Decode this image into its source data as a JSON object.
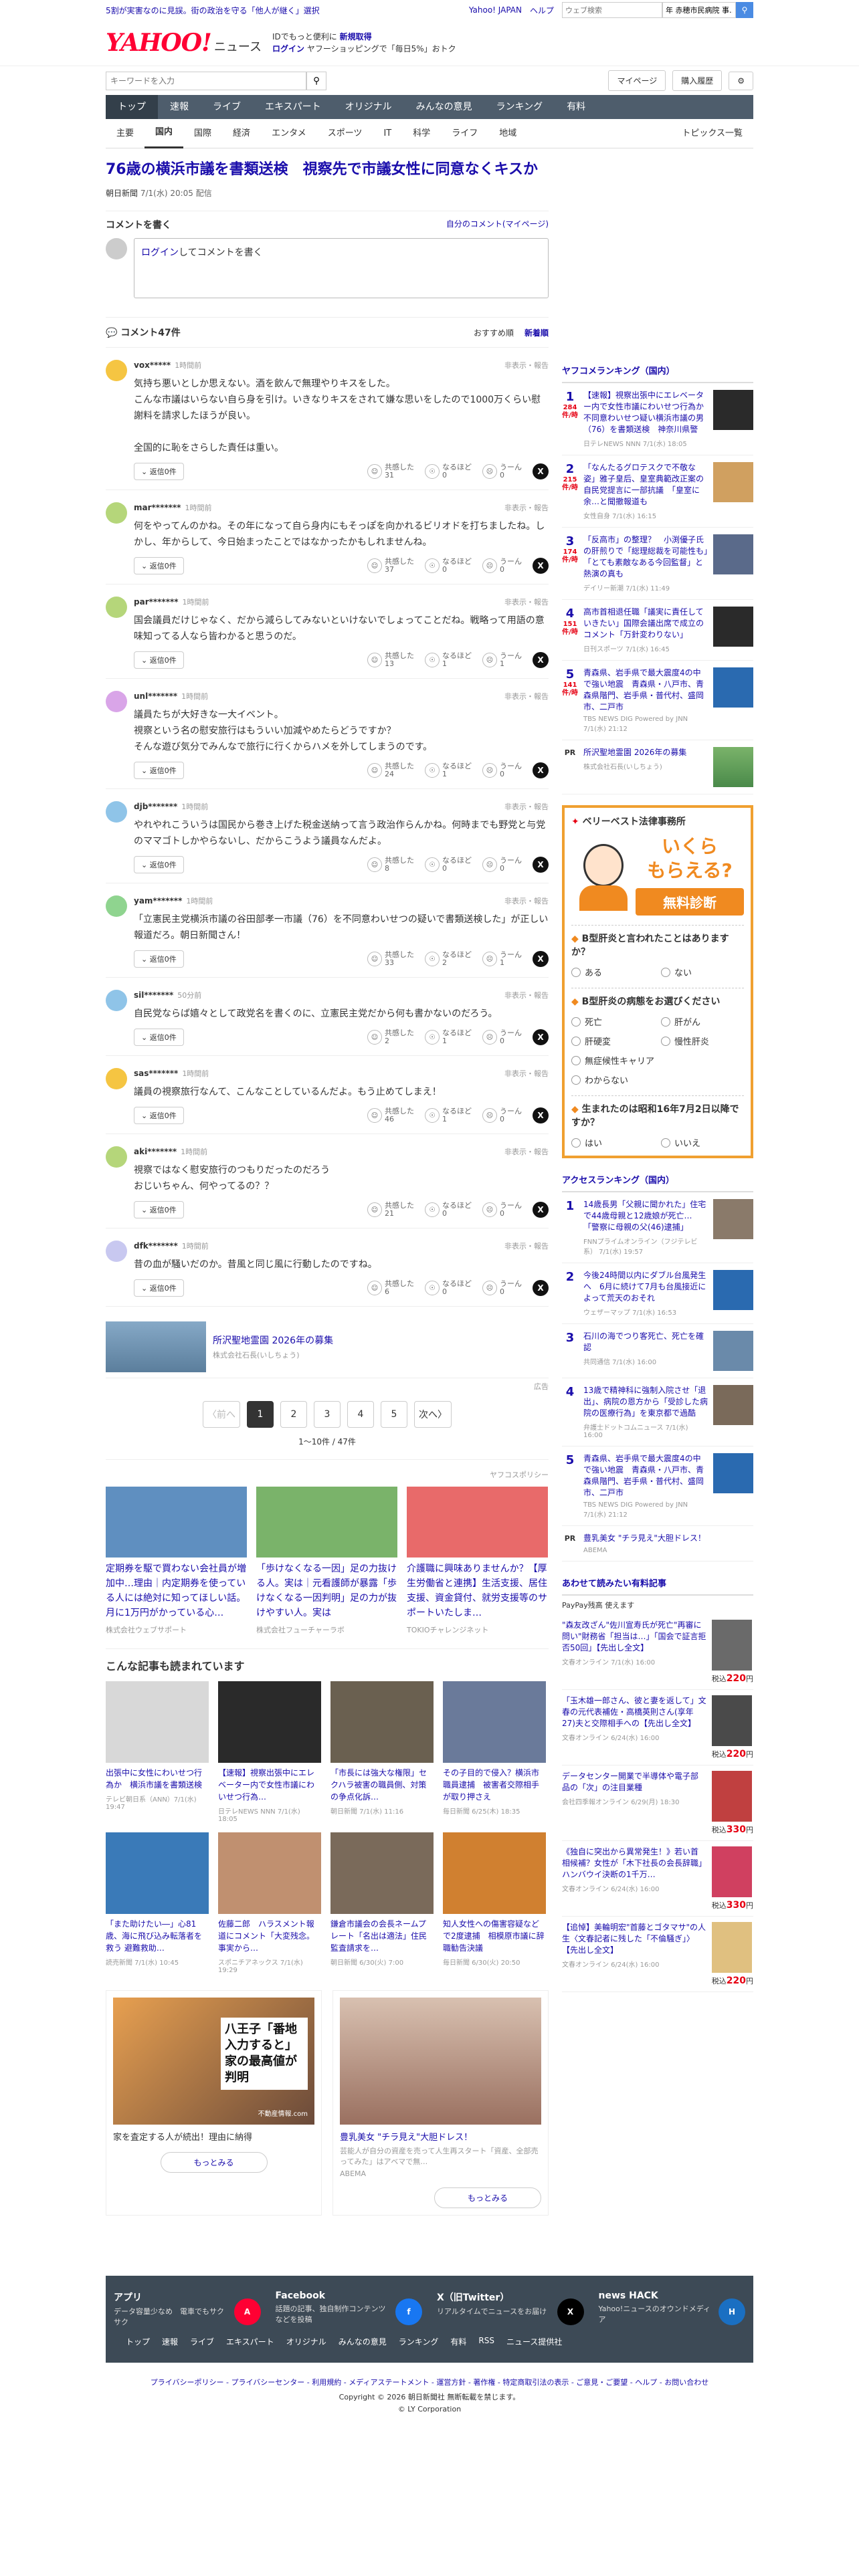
{
  "topbar": {
    "promo_prefix": "5割が業界歩手前…",
    "promo": "5割が実害なのに見誤。街の政治を守る「他人が継く」選択",
    "right_links": [
      "Yahoo! JAPAN",
      "ヘルプ"
    ],
    "search_placeholder": "ウェブ検索",
    "search_value": "年 赤穂市民病院 事…"
  },
  "header": {
    "logo_text": "YAHOO!",
    "logo_sub": "JAPAN",
    "logo_news": "ニュース",
    "line1_prefix": "IDでもっと便利に",
    "line1_link": "新規取得",
    "line2_link": "ログイン",
    "line2_text": "ヤフーショッピングで「毎日5%」おトク"
  },
  "searchrow": {
    "placeholder": "キーワードを入力",
    "mypage": "マイページ",
    "buy": "購入履歴"
  },
  "catnav": [
    "トップ",
    "速報",
    "ライブ",
    "エキスパート",
    "オリジナル",
    "みんなの意見",
    "ランキング",
    "有料"
  ],
  "subnav": [
    "主要",
    "国内",
    "国際",
    "経済",
    "エンタメ",
    "スポーツ",
    "IT",
    "科学",
    "ライフ",
    "地域"
  ],
  "subnav_right": "トピックス一覧",
  "article": {
    "title": "76歳の横浜市議を書類送検　視察先で市議女性に同意なくキスか",
    "source": "朝日新聞",
    "date": "7/1(水) 20:05 配信"
  },
  "comment_write": {
    "title": "コメントを書く",
    "mine": "自分のコメント(マイページ)",
    "login_link": "ログイン",
    "login_text": "してコメントを書く"
  },
  "comment_list": {
    "title": "コメント47件",
    "sort_rec": "おすすめ順",
    "sort_new": "新着順"
  },
  "comments": [
    {
      "user": "vox*****",
      "time": "1時間前",
      "text": "気持ち悪いとしか思えない。酒を飲んで無理やりキスをした。\nこんな市議はいらない自ら身を引け。いきなりキスをされて嫌な思いをしたので1000万くらい慰謝料を請求したほうが良い。\n\n全国的に恥をさらした責任は重い。",
      "react": [
        "共感した\n31",
        "なるほど\n0",
        "うーん\n0"
      ],
      "avatar": "#f5c542"
    },
    {
      "user": "mar*******",
      "time": "1時間前",
      "text": "何をやってんのかね。その年になって自ら身内にもそっぽを向かれるビリオドを打ちましたね。しかし、年からして、今日始まったことではなかったかもしれませんね。",
      "react": [
        "共感した\n37",
        "なるほど\n0",
        "うーん\n0"
      ],
      "avatar": "#b5d67a"
    },
    {
      "user": "par*******",
      "time": "1時間前",
      "text": "国会議員だけじゃなく、だから減らしてみないといけないでしょってことだね。戦略って用語の意味知ってる人なら皆わかると思うのだ。",
      "react": [
        "共感した\n13",
        "なるほど\n1",
        "うーん\n1"
      ],
      "avatar": "#b5d67a"
    },
    {
      "user": "unl*******",
      "time": "1時間前",
      "text": "議員たちが大好きな一大イベント。\n視察という名の慰安旅行はもういい加減やめたらどうですか？\nそんな遊び気分でみんなで旅行に行くからハメを外してしまうのです。",
      "react": [
        "共感した\n24",
        "なるほど\n1",
        "うーん\n0"
      ],
      "avatar": "#d9a5e8"
    },
    {
      "user": "djb*******",
      "time": "1時間前",
      "text": "やれやれこういうは国民から巻き上げた税金送納って言う政治作らんかね。何時までも野党と与党のママゴトしかやらないし、だからこうよう議員なんだよ。",
      "react": [
        "共感した\n8",
        "なるほど\n0",
        "うーん\n0"
      ],
      "avatar": "#8fc4e8"
    },
    {
      "user": "yam*******",
      "time": "1時間前",
      "text": "「立憲民主党横浜市議の谷田部孝一市議（76）を不同意わいせつの疑いで書類送検した」が正しい報道だろ。朝日新聞さん！",
      "react": [
        "共感した\n33",
        "なるほど\n2",
        "うーん\n1"
      ],
      "avatar": "#8fd48f"
    },
    {
      "user": "sil*******",
      "time": "50分前",
      "text": "自民党ならば嬉々として政党名を書くのに、立憲民主党だから何も書かないのだろう。",
      "react": [
        "共感した\n2",
        "なるほど\n1",
        "うーん\n0"
      ],
      "avatar": "#8fc4e8"
    },
    {
      "user": "sas*******",
      "time": "1時間前",
      "text": "議員の視察旅行なんて、こんなことしているんだよ。もう止めてしまえ！",
      "react": [
        "共感した\n46",
        "なるほど\n1",
        "うーん\n0"
      ],
      "avatar": "#f5c542"
    },
    {
      "user": "aki*******",
      "time": "1時間前",
      "text": "視察ではなく慰安旅行のつもりだったのだろう\nおじいちゃん、何やってるの？？",
      "react": [
        "共感した\n21",
        "なるほど\n0",
        "うーん\n0"
      ],
      "avatar": "#b5d67a"
    },
    {
      "user": "dfk*******",
      "time": "1時間前",
      "text": "昔の血が騒いだのか。昔風と同じ風に行動したのですね。",
      "react": [
        "共感した\n6",
        "なるほど\n0",
        "うーん\n0"
      ],
      "avatar": "#c8c8f0"
    }
  ],
  "reply_label": "返信0件",
  "report_label": "非表示・報告",
  "ad_strip": {
    "title": "所沢聖地霊園 2026年の募集",
    "sub": "株式会社石長(いしちょう)",
    "label": "広告"
  },
  "pager": {
    "prev": "〈前へ",
    "pages": [
      "1",
      "2",
      "3",
      "4",
      "5"
    ],
    "next": "次へ〉",
    "count": "1〜10件 / 47件"
  },
  "yad_label": "ヤフコスポリシー",
  "yads": [
    {
      "title": "定期券を駆で買わない会社員が増加中…理由｜内定期券を使っている人には絶対に知ってほしい話。月に1万円がかっている心…",
      "sub": "株式会社ウェブサポート",
      "color": "#5f8fc0"
    },
    {
      "title": "「歩けなくなる一因」足の力抜ける人。実は｜元看護師が暴露「歩けなくなる一因判明」足の力が抜けやすい人。実は",
      "sub": "株式会社フューチャーラボ",
      "color": "#7ab36a"
    },
    {
      "title": "介護職に興味ありませんか？【厚生労働省と連携】生活支援、居住支援、資金貸付、就労支援等のサポートいたしま…",
      "sub": "TOKIOチャレンジネット",
      "color": "#e86a6a"
    }
  ],
  "also_title": "こんな記事も読まれています",
  "related": [
    {
      "title": "出張中に女性にわいせつ行為か　横浜市議を書類送検",
      "sub": "テレビ朝日系（ANN）7/1(水) 19:47",
      "color": "#d8d8d8"
    },
    {
      "title": "【速報】視察出張中にエレベーター内で女性市議にわいせつ行為…",
      "sub": "日テレNEWS NNN 7/1(水) 18:05",
      "color": "#2a2a2a"
    },
    {
      "title": "「市長には強大な権限」セクハラ被害の職員側、対策の争点化訴…",
      "sub": "朝日新聞 7/1(水) 11:16",
      "color": "#6a6050"
    },
    {
      "title": "その子目的で侵入？横浜市職員逮捕　被害者交際相手が取り押さえ",
      "sub": "毎日新聞 6/25(木) 18:35",
      "color": "#6a7a9a"
    },
    {
      "title": "「また助けたい―」心81歳、海に飛び込み転落者を救う 避難救助…",
      "sub": "読売新聞 7/1(水) 10:45",
      "color": "#3a7ab8"
    },
    {
      "title": "佐藤二郎　ハラスメント報道にコメント「大変残念。事実から…",
      "sub": "スポニチアネックス 7/1(水) 19:29",
      "color": "#c09070"
    },
    {
      "title": "鎌倉市議会の会長ネームプレート「名出は適法」住民監査請求を…",
      "sub": "朝日新聞 6/30(火) 7:00",
      "color": "#7a6a5a"
    },
    {
      "title": "知人女性への傷害容疑などで2度逮捕　相模原市議に辞職勧告決議",
      "sub": "毎日新聞 6/30(火) 20:50",
      "color": "#d08030"
    }
  ],
  "promo_cards": [
    {
      "label": "広告",
      "title": "家を査定する人が続出！理由に納得",
      "more": "もっとみる",
      "headline": "八王子「番地入力すると」家の最高値が判明",
      "sub": "不動産情報.com"
    },
    {
      "label": "",
      "title": "豊乳美女 \"チラ見え\"大胆ドレス！",
      "sub2": "芸能人が自分の資産を売って人生再スタート「資産、全部売ってみた」はアベマで無…",
      "sub3": "ABEMA",
      "more": "もっとみる"
    }
  ],
  "side": {
    "rank1_title": "ヤフコメランキング（国内）",
    "rank1": [
      {
        "n": "1",
        "c": "284\n件/時",
        "t": "【速報】視察出張中にエレベーター内で女性市議にわいせつ行為か　不同意わいせつ疑い横浜市議の男（76）を書類送検　神奈川県警",
        "s": "日テレNEWS NNN 7/1(水) 18:05",
        "color": "#2a2a2a"
      },
      {
        "n": "2",
        "c": "215\n件/時",
        "t": "「なんたるグロテスクで不敬な姿」雅子皇后、皇室典範改正案の自民党提言に一部抗議　「皇室に余…と聞撤報道も",
        "s": "女性自身 7/1(水) 16:15",
        "color": "#d0a060"
      },
      {
        "n": "3",
        "c": "174\n件/時",
        "t": "「反高市」の整理？　小渕優子氏の肝煎りで「総理総裁を可能性も」「とても素敵なある今回監督」と熱演の真も",
        "s": "デイリー新潮 7/1(水) 11:49",
        "color": "#5a6a8a"
      },
      {
        "n": "4",
        "c": "151\n件/時",
        "t": "高市首相退任職「議実に責任していきたい」国際会議出席で成立のコメント「万針変わりない」",
        "s": "日刊スポーツ 7/1(水) 16:45",
        "color": "#2a2a2a"
      },
      {
        "n": "5",
        "c": "141\n件/時",
        "t": "青森県、岩手県で最大震度4の中で強い地震　青森県・八戸市、青森県階門、岩手県・普代村、盛岡市、二戸市",
        "s": "TBS NEWS DIG Powered by JNN 7/1(水) 21:12",
        "color": "#2a6ab0"
      }
    ],
    "pr": {
      "label": "PR",
      "t": "所沢聖地霊園 2026年の募集",
      "s": "株式会社石長(いしちょう)"
    },
    "ad": {
      "brand": "ベリーベスト法律事務所",
      "line1": "いくら",
      "line2": "もらえる?",
      "cta": "無料診断",
      "q1": "B型肝炎と言われたことはありますか？",
      "q1_opts": [
        "ある",
        "ない"
      ],
      "q2": "B型肝炎の病態をお選びください",
      "q2_opts": [
        "死亡",
        "肝がん",
        "肝硬変",
        "慢性肝炎",
        "無症候性キャリア",
        "わからない"
      ],
      "q3": "生まれたのは昭和16年7月2日以降ですか？",
      "q3_opts": [
        "はい",
        "いいえ"
      ]
    },
    "rank2_title": "アクセスランキング（国内）",
    "rank2": [
      {
        "n": "1",
        "t": "14歳長男「父親に聞かれた」住宅で44歳母親と12歳娘が死亡…「警察に母親の父(46)逮捕」",
        "s": "FNNプライムオンライン（フジテレビ系） 7/1(水) 19:57",
        "color": "#8a7a6a"
      },
      {
        "n": "2",
        "t": "今後24時間以内にダブル台風発生へ　6月に続けて7月も台風接近によって荒天のおそれ",
        "s": "ウェザーマップ 7/1(水) 16:53",
        "color": "#2a6ab0"
      },
      {
        "n": "3",
        "t": "石川の海でつり客死亡、死亡を確認",
        "s": "共同通信 7/1(水) 16:00",
        "color": "#6a8aaa"
      },
      {
        "n": "4",
        "t": "13歳で精神科に強制入院させ「退出」、病院の恩方から「受診した病院の医療行為」を東京都で過酷",
        "s": "弁護士ドットコムニュース 7/1(水) 16:00",
        "color": "#7a6a5a"
      },
      {
        "n": "5",
        "t": "青森県、岩手県で最大震度4の中で強い地震　青森県・八戸市、青森県階門、岩手県・普代村、盛岡市、二戸市",
        "s": "TBS NEWS DIG Powered by JNN 7/1(水) 21:12",
        "color": "#2a6ab0"
      }
    ],
    "pr2": {
      "label": "PR",
      "t": "豊乳美女 \"チラ見え\"大胆ドレス！",
      "s": "ABEMA"
    },
    "shop_title": "あわせて読みたい有料記事",
    "shop_sub": "PayPay残高 使えます",
    "shop": [
      {
        "t": "\"森友改ざん\"佐川宣寿氏が死亡\"再審に問い\"財務省「担当は…」「国会で証言拒否50回」【先出し全文】",
        "s": "文春オンライン 7/1(水) 16:00",
        "p": "220",
        "color": "#6a6a6a"
      },
      {
        "t": "「玉木雄一郎さん、彼と妻を返して」文春の元代表補佐・高橋英則さん(享年27)夫と交際相手への【先出し全文】",
        "s": "文春オンライン 6/24(水) 16:00",
        "p": "220",
        "color": "#4a4a4a"
      },
      {
        "t": "データセンター開業で半導体や電子部品の「次」の注目業種",
        "s": "会社四季報オンライン 6/29(月) 18:30",
        "p": "330",
        "color": "#c04040"
      },
      {
        "t": "《独自に突出から異常発生！》若い首相候補？女性が「木下社長の会長辞職」ハンバウイ決断の1千万…",
        "s": "文春オンライン 6/24(水) 16:00",
        "p": "330",
        "color": "#d04060"
      },
      {
        "t": "【追悼】美輪明宏\"首藤とゴタマサ\"の人生〈文春記者に残した「不倫騒ぎ」〉【先出し全文】",
        "s": "文春オンライン 6/24(水) 16:00",
        "p": "220",
        "color": "#e0c080"
      }
    ]
  },
  "footer": {
    "cols": [
      {
        "t": "アプリ",
        "d": "データ容量少なめ　電車でもサクサク",
        "icon": "A",
        "color": "#ff0033"
      },
      {
        "t": "Facebook",
        "d": "話題の記事、独自制作コンテンツなどを投稿",
        "icon": "f",
        "color": "#1877f2"
      },
      {
        "t": "X（旧Twitter）",
        "d": "リアルタイムでニュースをお届け",
        "icon": "X",
        "color": "#000000"
      },
      {
        "t": "news HACK",
        "d": "Yahoo!ニュースのオウンドメディア",
        "icon": "H",
        "color": "#1a6fc2"
      }
    ],
    "nav": [
      "トップ",
      "速報",
      "ライブ",
      "エキスパート",
      "オリジナル",
      "みんなの意見",
      "ランキング",
      "有料",
      "RSS",
      "ニュース提供社"
    ],
    "links": "プライバシーポリシー - プライバシーセンター - 利用規約 - メディアステートメント - 運営方針 - 著作権 - 特定商取引法の表示 - ご意見・ご要望 - ヘルプ - お問い合わせ",
    "copy1": "Copyright © 2026 朝日新聞社 無断転載を禁じます。",
    "copy2": "© LY Corporation"
  }
}
